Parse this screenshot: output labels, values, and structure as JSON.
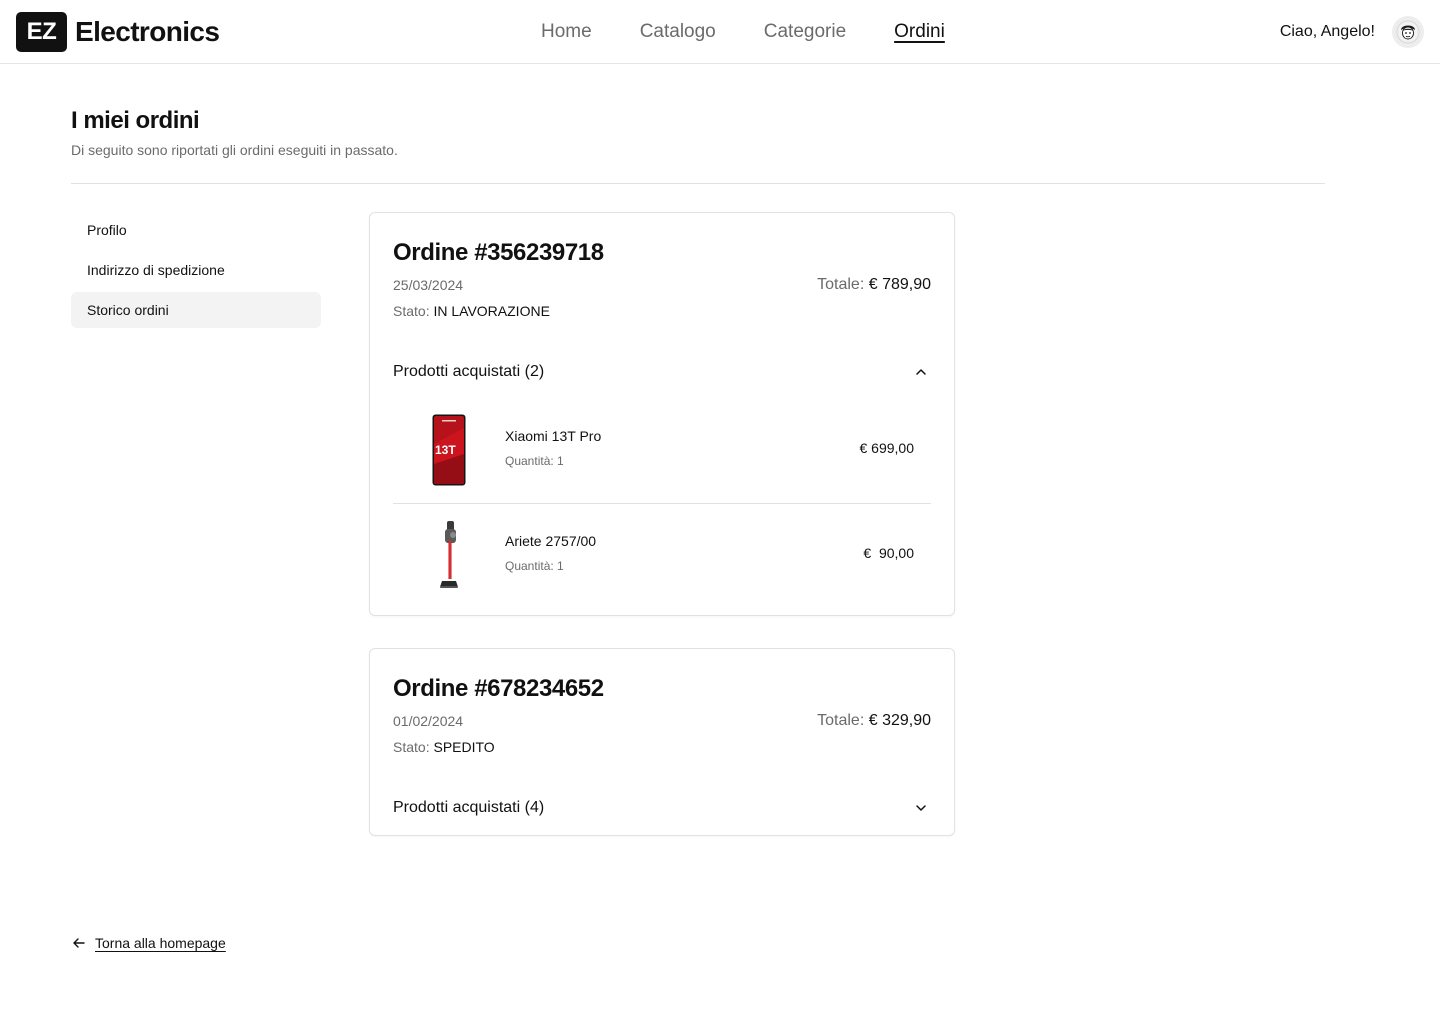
{
  "header": {
    "logo_mark": "EZ",
    "logo_text": "Electronics",
    "nav": [
      {
        "label": "Home"
      },
      {
        "label": "Catalogo"
      },
      {
        "label": "Categorie"
      },
      {
        "label": "Ordini",
        "active": true
      }
    ],
    "greeting": "Ciao, Angelo!",
    "avatar_icon": "user-avatar-icon"
  },
  "page": {
    "title": "I miei ordini",
    "subtitle": "Di seguito sono riportati gli ordini eseguiti in passato."
  },
  "sidebar": {
    "items": [
      {
        "label": "Profilo"
      },
      {
        "label": "Indirizzo di spedizione"
      },
      {
        "label": "Storico ordini",
        "active": true
      }
    ]
  },
  "orders": [
    {
      "title": "Ordine #356239718",
      "date": "25/03/2024",
      "status_label": "Stato:",
      "status": "IN LAVORAZIONE",
      "total_label": "Totale:",
      "total": "€ 789,90",
      "products_label": "Prodotti acquistati (2)",
      "expanded": true,
      "products": [
        {
          "name": "Xiaomi 13T Pro",
          "qty": "Quantità: 1",
          "price": "€ 699,00",
          "image_icon": "smartphone-image",
          "image_text": "13T"
        },
        {
          "name": "Ariete 2757/00",
          "qty": "Quantità: 1",
          "price": "€  90,00",
          "image_icon": "vacuum-cleaner-image"
        }
      ]
    },
    {
      "title": "Ordine #678234652",
      "date": "01/02/2024",
      "status_label": "Stato:",
      "status": "SPEDITO",
      "total_label": "Totale:",
      "total": "€ 329,90",
      "products_label": "Prodotti acquistati (4)",
      "expanded": false
    }
  ],
  "back_link": "Torna alla homepage",
  "colors": {
    "text": "#111111",
    "muted": "#6b6b6b",
    "border": "#e2e2e2",
    "active_bg": "#f3f3f3",
    "phone_red": "#c8141b"
  }
}
